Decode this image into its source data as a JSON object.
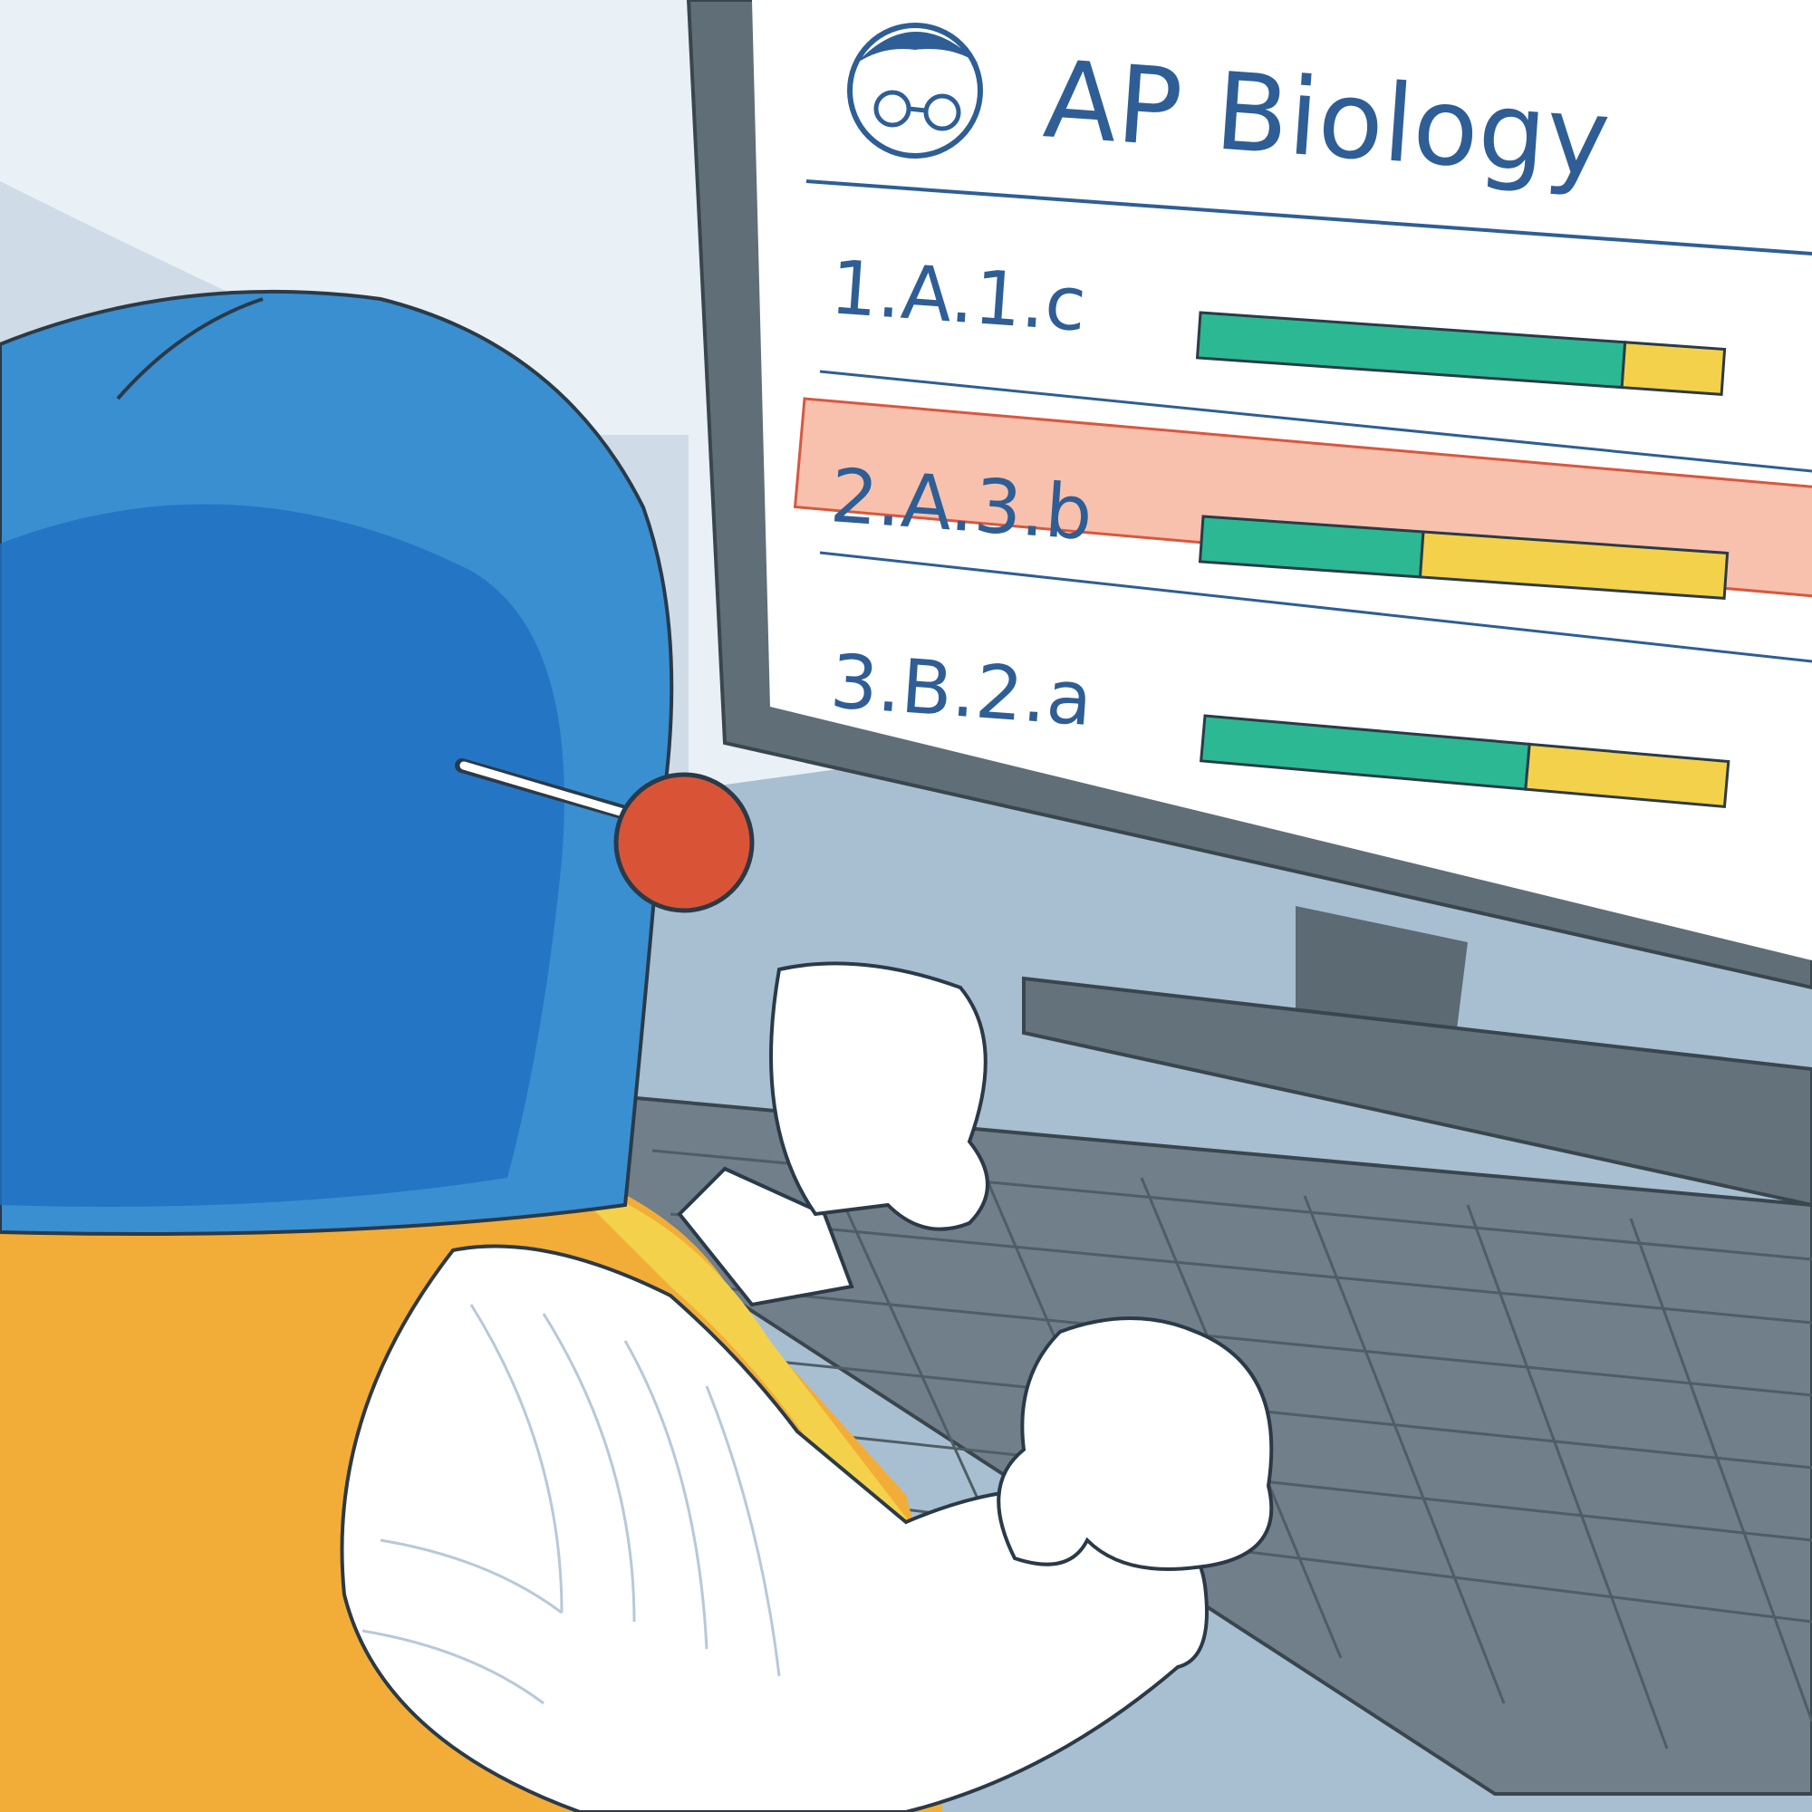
{
  "screen": {
    "title": "AP Biology",
    "rows": [
      {
        "code": "1.A.1.c",
        "mastered": 0.81,
        "in_progress": 0.19,
        "highlighted": false
      },
      {
        "code": "2.A.3.b",
        "mastered": 0.42,
        "in_progress": 0.58,
        "highlighted": true
      },
      {
        "code": "3.B.2.a",
        "mastered": 0.62,
        "in_progress": 0.38,
        "highlighted": false
      }
    ]
  },
  "colors": {
    "text": "#2e5e95",
    "bar_mastered": "#2cb892",
    "bar_in_progress": "#f4d14a",
    "highlight": "#f7c1ad",
    "highlight_border": "#d9573d",
    "helmet": "#3a8fd0",
    "helmet_dark": "#1f6fc0",
    "suit_yellow": "#f2ad38",
    "monitor": "#5f6e77",
    "keyboard": "#70818b",
    "antenna_ball": "#d95436"
  },
  "icons": [
    "teacher-avatar-icon"
  ]
}
